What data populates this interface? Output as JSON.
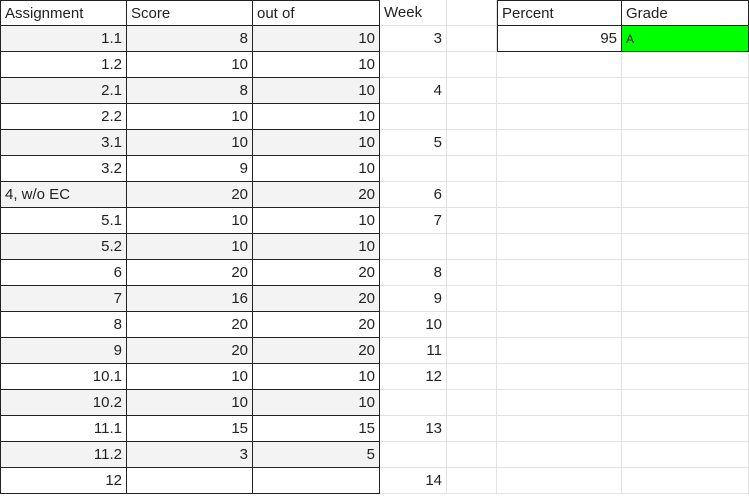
{
  "headers": {
    "assignment": "Assignment",
    "score": "Score",
    "out_of": "out of",
    "week": "Week",
    "percent": "Percent",
    "grade": "Grade"
  },
  "summary": {
    "percent": "95",
    "grade": "A"
  },
  "rows": [
    {
      "assignment": "1.1",
      "score": "8",
      "out_of": "10",
      "week": "3"
    },
    {
      "assignment": "1.2",
      "score": "10",
      "out_of": "10",
      "week": ""
    },
    {
      "assignment": "2.1",
      "score": "8",
      "out_of": "10",
      "week": "4"
    },
    {
      "assignment": "2.2",
      "score": "10",
      "out_of": "10",
      "week": ""
    },
    {
      "assignment": "3.1",
      "score": "10",
      "out_of": "10",
      "week": "5"
    },
    {
      "assignment": "3.2",
      "score": "9",
      "out_of": "10",
      "week": ""
    },
    {
      "assignment": "4, w/o EC",
      "score": "20",
      "out_of": "20",
      "week": "6"
    },
    {
      "assignment": "5.1",
      "score": "10",
      "out_of": "10",
      "week": "7"
    },
    {
      "assignment": "5.2",
      "score": "10",
      "out_of": "10",
      "week": ""
    },
    {
      "assignment": "6",
      "score": "20",
      "out_of": "20",
      "week": "8"
    },
    {
      "assignment": "7",
      "score": "16",
      "out_of": "20",
      "week": "9"
    },
    {
      "assignment": "8",
      "score": "20",
      "out_of": "20",
      "week": "10"
    },
    {
      "assignment": "9",
      "score": "20",
      "out_of": "20",
      "week": "11"
    },
    {
      "assignment": "10.1",
      "score": "10",
      "out_of": "10",
      "week": "12"
    },
    {
      "assignment": "10.2",
      "score": "10",
      "out_of": "10",
      "week": ""
    },
    {
      "assignment": "11.1",
      "score": "15",
      "out_of": "15",
      "week": "13"
    },
    {
      "assignment": "11.2",
      "score": "3",
      "out_of": "5",
      "week": ""
    },
    {
      "assignment": "12",
      "score": "",
      "out_of": "",
      "week": "14"
    }
  ],
  "colors": {
    "grade_fill": "#00ff00",
    "row_shade": "#f3f3f3",
    "border": "#222222",
    "gridline": "#e2e2e2"
  }
}
